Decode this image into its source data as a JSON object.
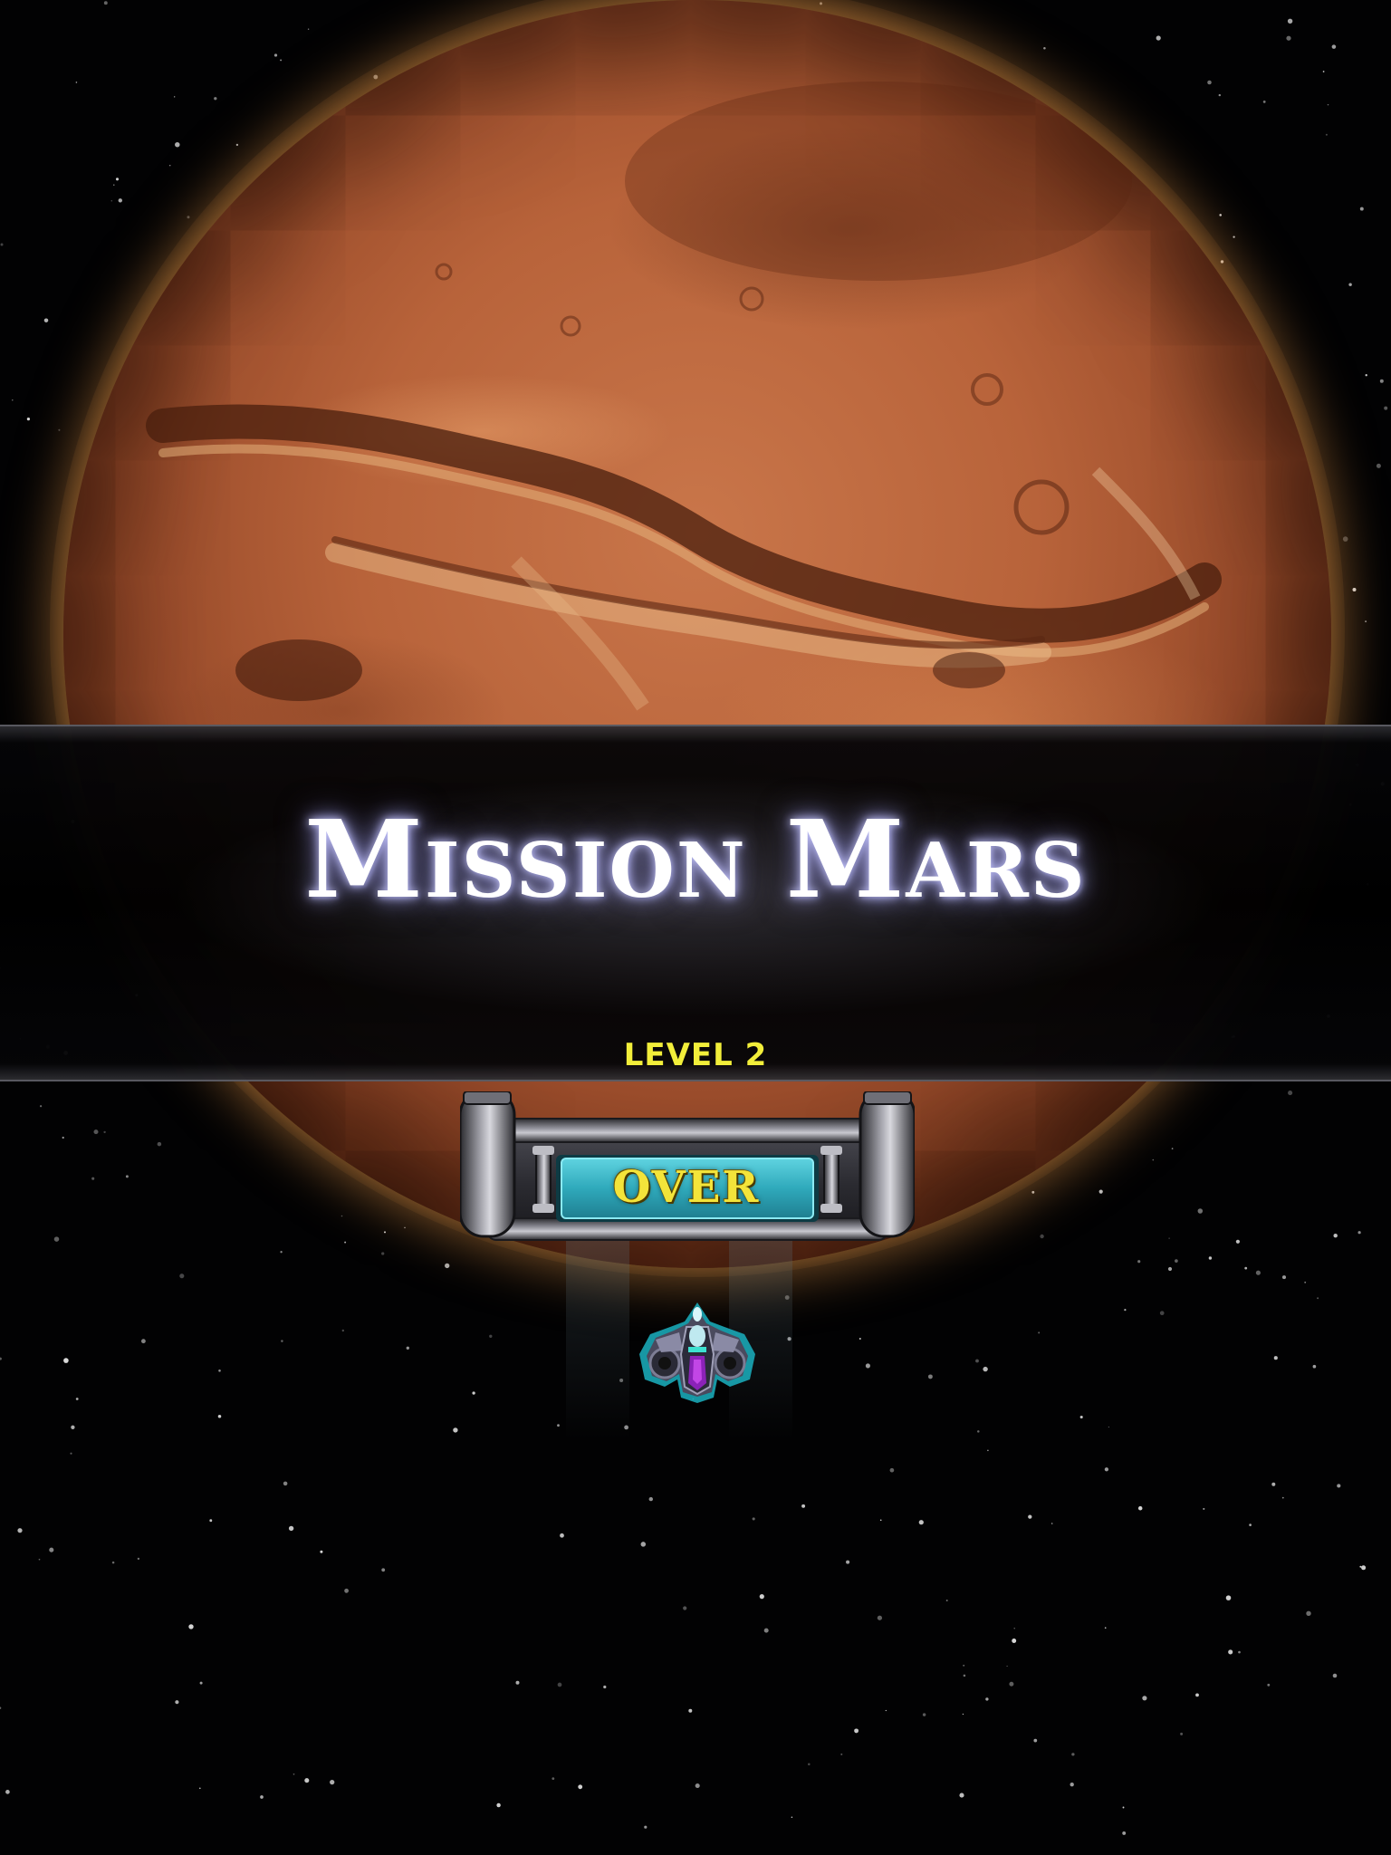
{
  "game": {
    "title": "Mission Mars",
    "level_label": "LEVEL 2",
    "status_button_label": "OVER"
  },
  "colors": {
    "title_text": "#ffffff",
    "title_glow": "#a0a0e6",
    "level_text": "#f2ee3a",
    "button_face": "#38b8c8",
    "button_text": "#f3e43a",
    "planet": "#b8633a",
    "space": "#020203"
  },
  "icons": {
    "background_planet": "mars-planet",
    "player": "spaceship-icon"
  }
}
